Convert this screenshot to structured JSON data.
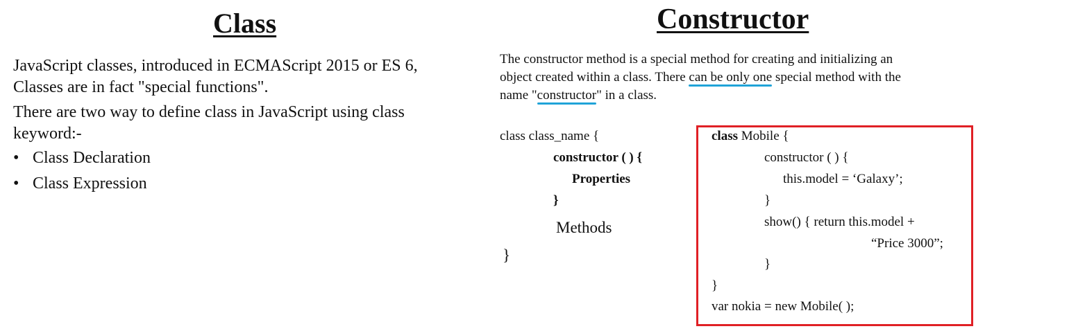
{
  "left": {
    "title": "Class",
    "para1_line1": "JavaScript classes, introduced in ECMAScript 2015 or ES 6,",
    "para1_line2": "Classes are in fact \"special functions\".",
    "para2_line1": "There are two way to define class in JavaScript using class",
    "para2_line2": "keyword:-",
    "bullet_symbol": "•",
    "bullets": [
      "Class Declaration",
      "Class Expression"
    ]
  },
  "right": {
    "title": "Constructor",
    "desc_line1": "The constructor method is a special method for creating and initializing an",
    "desc_line2_pre": "object created within a class. There ",
    "desc_line2_hl": "can be only one",
    "desc_line2_post": " special method with the",
    "desc_line3_pre": "name \"",
    "desc_line3_hl": "constructor",
    "desc_line3_post": "\" in a class.",
    "highlight_color": "#1fa3d8",
    "syntax": [
      "class class_name {",
      "constructor ( ) {",
      "Properties",
      "}",
      "Methods",
      "}"
    ],
    "code_keyword": "class",
    "code_first_rest": " Mobile {",
    "code": [
      "constructor ( ) {",
      "this.model = ‘Galaxy’;",
      "}",
      "show() { return this.model +",
      "“Price 3000”;",
      "}",
      "}",
      "var nokia = new Mobile( );"
    ],
    "code_box_color": "#e02025"
  }
}
